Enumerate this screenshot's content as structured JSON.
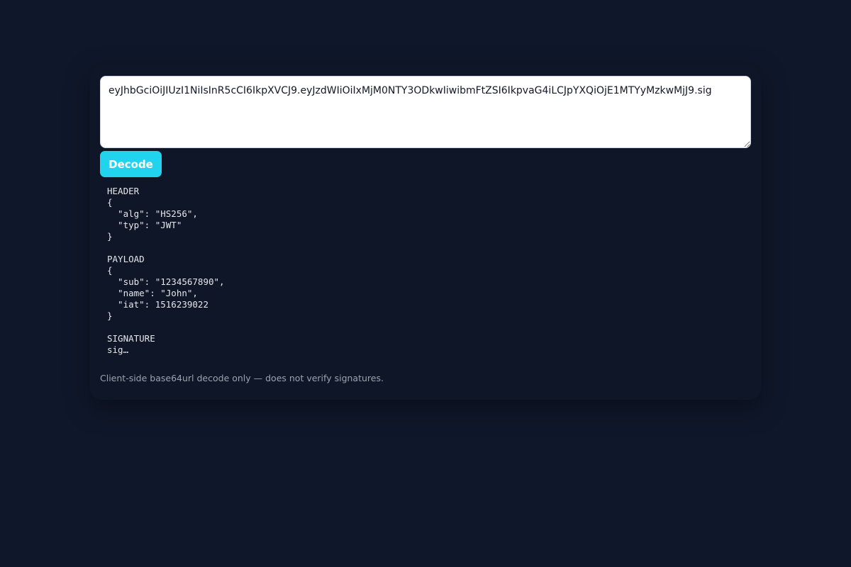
{
  "token_input": {
    "value": "eyJhbGciOiJIUzI1NiIsInR5cCI6IkpXVCJ9.eyJzdWIiOiIxMjM0NTY3ODkwIiwibmFtZSI6IkpvaG4iLCJpYXQiOjE1MTYyMzkwMjJ9.sig"
  },
  "decode_button": {
    "label": "Decode"
  },
  "output": {
    "header": {
      "title": "HEADER",
      "body": "{\n  \"alg\": \"HS256\",\n  \"typ\": \"JWT\"\n}"
    },
    "payload": {
      "title": "PAYLOAD",
      "body": "{\n  \"sub\": \"1234567890\",\n  \"name\": \"John\",\n  \"iat\": 1516239022\n}"
    },
    "signature": {
      "title": "SIGNATURE",
      "body": "sig…"
    }
  },
  "footnote": "Client-side base64url decode only — does not verify signatures.",
  "colors": {
    "page_background": "#0f172a",
    "card_background": "#0e1627",
    "accent": "#22d3ee"
  }
}
